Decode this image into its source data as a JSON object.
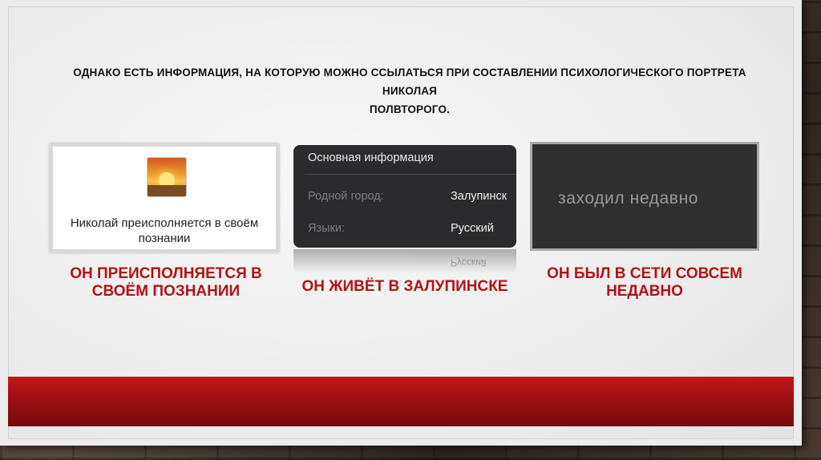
{
  "slide": {
    "title_line1": "ОДНАКО ЕСТЬ ИНФОРМАЦИЯ, НА КОТОРУЮ МОЖНО ССЫЛАТЬСЯ  ПРИ СОСТАВЛЕНИИ ПСИХОЛОГИЧЕСКОГО ПОРТРЕТА НИКОЛАЯ",
    "title_line2": "ПОЛВТОРОГО."
  },
  "card1": {
    "avatar_icon": "sunset-avatar-icon",
    "status_line1": "Николай преисполняется в своём",
    "status_line2": "познании",
    "caption_line1": "ОН ПРЕИСПОЛНЯЕТСЯ В",
    "caption_line2": "СВОЁМ ПОЗНАНИИ"
  },
  "card2": {
    "header": "Основная информация",
    "rows": [
      {
        "label": "Родной город:",
        "value": "Залупинск"
      },
      {
        "label": "Языки:",
        "value": "Русский"
      }
    ],
    "reflection": "Русский",
    "caption": "ОН ЖИВЁТ В ЗАЛУПИНСКЕ"
  },
  "card3": {
    "status": "заходил недавно",
    "caption_line1": "ОН БЫЛ В СЕТИ СОВСЕМ",
    "caption_line2": "НЕДАВНО"
  },
  "colors": {
    "accent": "#b01416",
    "band": "#a01014",
    "dark_card": "#2b2b2d"
  }
}
